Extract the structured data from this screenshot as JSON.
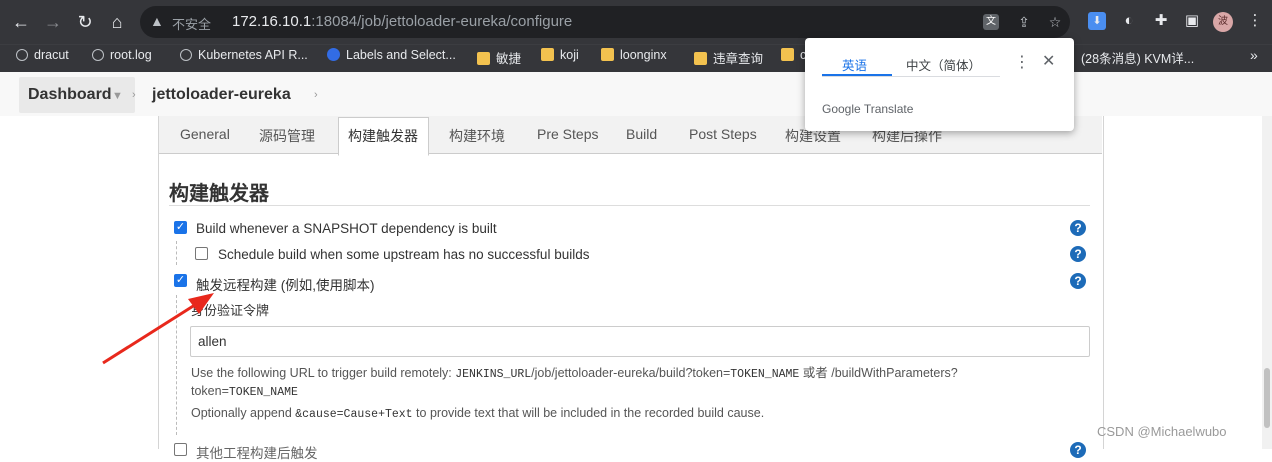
{
  "browser": {
    "security_label": "不安全",
    "url_host": "172.16.10.1",
    "url_rest": ":18084/job/jettoloader-eureka/configure",
    "profile_initial": "波"
  },
  "bookmarks": [
    {
      "label": "dracut",
      "icon": "globe-icon"
    },
    {
      "label": "root.log",
      "icon": "globe-icon"
    },
    {
      "label": "Kubernetes API R...",
      "icon": "globe-icon"
    },
    {
      "label": "Labels and Select...",
      "icon": "kubernetes-icon"
    },
    {
      "label": "敏捷",
      "icon": "folder-icon"
    },
    {
      "label": "koji",
      "icon": "folder-icon"
    },
    {
      "label": "loonginx",
      "icon": "folder-icon"
    },
    {
      "label": "违章查询",
      "icon": "folder-icon"
    },
    {
      "label": "c",
      "icon": "folder-icon"
    },
    {
      "label": "(28条消息) KVM详...",
      "icon": ""
    }
  ],
  "translate_popup": {
    "tab_source": "英语",
    "tab_target": "中文（简体）",
    "brand": "Google Translate"
  },
  "breadcrumb": {
    "dashboard": "Dashboard",
    "job": "jettoloader-eureka"
  },
  "tabs": [
    "General",
    "源码管理",
    "构建触发器",
    "构建环境",
    "Pre Steps",
    "Build",
    "Post Steps",
    "构建设置",
    "构建后操作"
  ],
  "active_tab": "构建触发器",
  "section": {
    "title": "构建触发器",
    "options": [
      {
        "label": "Build whenever a SNAPSHOT dependency is built",
        "checked": true
      },
      {
        "label": "Schedule build when some upstream has no successful builds",
        "checked": false
      },
      {
        "label": "触发远程构建 (例如,使用脚本)",
        "checked": true
      }
    ],
    "token_label": "身份验证令牌",
    "token_value": "allen",
    "desc1_a": "Use the following URL to trigger build remotely: ",
    "desc1_code1": "JENKINS_URL",
    "desc1_b": "/job/jettoloader-eureka/build?token=",
    "desc1_code2": "TOKEN_NAME",
    "desc1_c": " 或者 /buildWithParameters?",
    "desc2_a": "token=",
    "desc2_code": "TOKEN_NAME",
    "desc3_a": "Optionally append ",
    "desc3_code": "&cause=Cause+Text",
    "desc3_b": " to provide text that will be included in the recorded build cause.",
    "next_option": "其他工程构建后触发"
  },
  "help_symbol": "?",
  "watermark": "CSDN @Michaelwubo",
  "colors": {
    "annotation_arrow": "#e8281c",
    "checkbox": "#1a73e8",
    "help": "#1d6bb8"
  }
}
